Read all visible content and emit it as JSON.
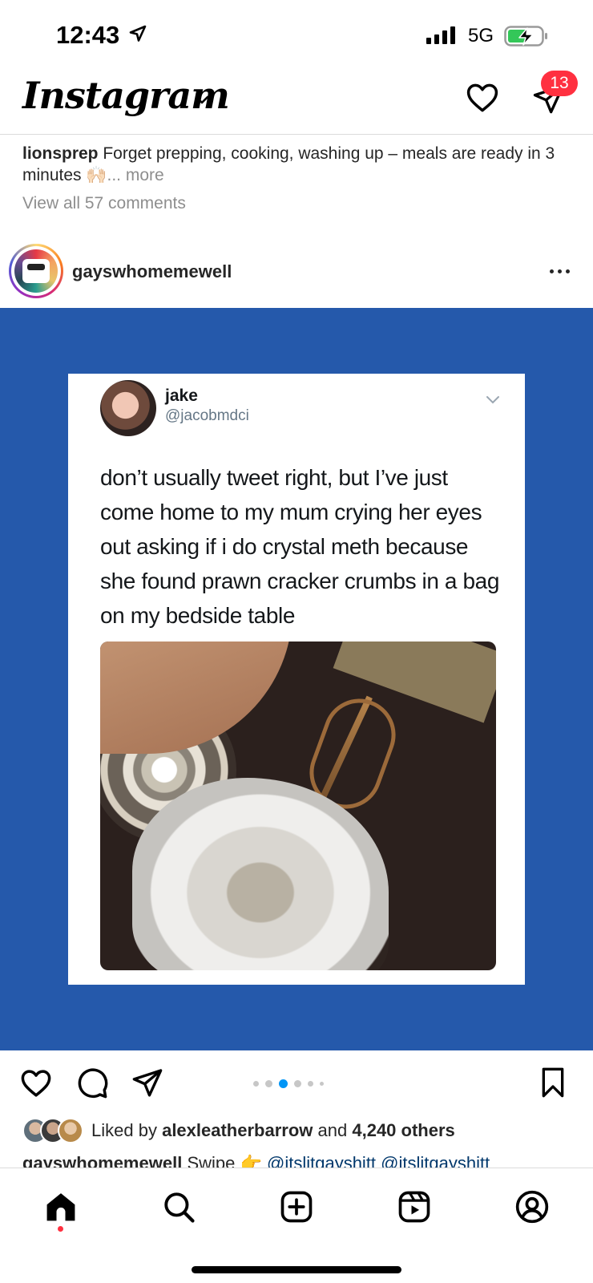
{
  "status_bar": {
    "time": "12:43",
    "network": "5G"
  },
  "header": {
    "logo": "Instagram",
    "notifications_badge": "13"
  },
  "previous_post": {
    "username": "lionsprep",
    "caption": "Forget prepping, cooking, washing up – meals are ready in 3 minutes 🙌🏻",
    "more": "... more",
    "view_comments": "View all 57 comments"
  },
  "post": {
    "username": "gayswhomemewell",
    "tweet": {
      "name": "jake",
      "handle": "@jacobmdci",
      "text": "don’t usually tweet right, but I’ve just come home to my mum crying her eyes out asking if i do crystal meth because she found prawn cracker crumbs in a bag on my bedside table"
    },
    "carousel": {
      "total": 6,
      "active": 3
    },
    "likes": {
      "prefix": "Liked by",
      "user": "alexleatherbarrow",
      "and": "and",
      "others": "4,240 others"
    },
    "caption": {
      "username": "gayswhomemewell",
      "text": "Swipe 👉",
      "tags": "@itslitgayshitt @itslitgayshitt"
    }
  },
  "nav": {
    "items": [
      "home",
      "search",
      "create",
      "reels",
      "profile"
    ],
    "active": "home"
  },
  "colors": {
    "post_background": "#2559ab",
    "badge": "#ff3040",
    "link": "#00376b",
    "carousel_active": "#0095f6"
  }
}
